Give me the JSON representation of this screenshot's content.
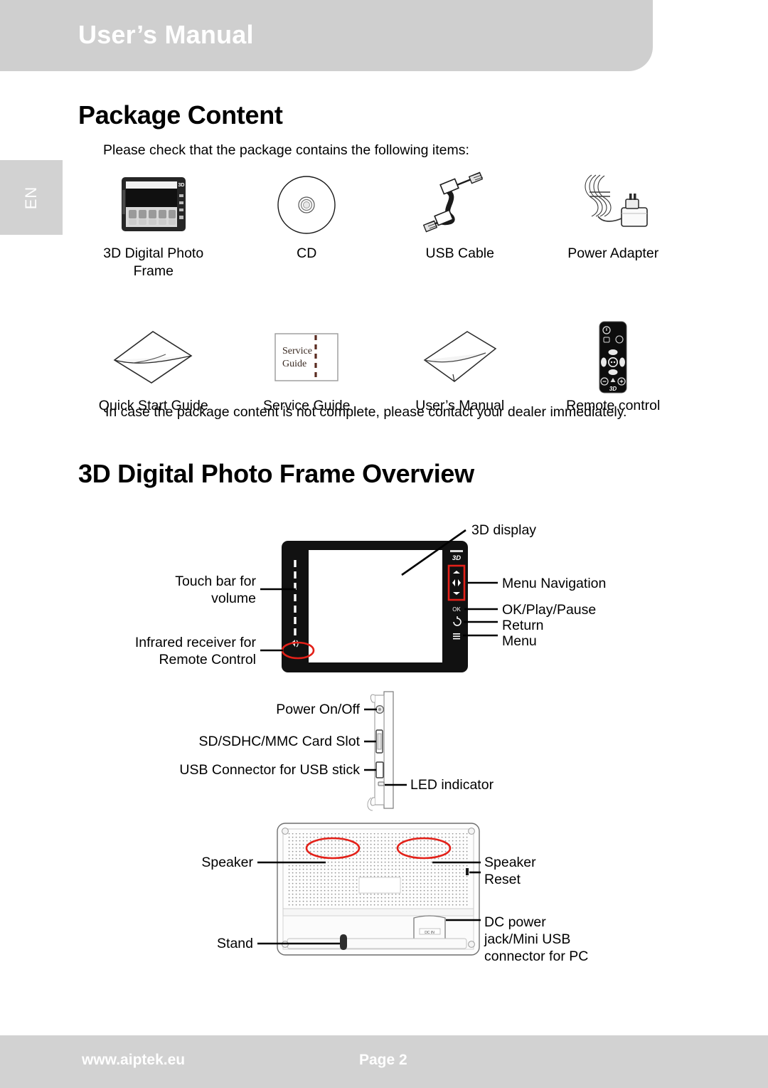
{
  "header": {
    "title": "User’s Manual"
  },
  "language_tab": {
    "label": "EN"
  },
  "footer": {
    "url": "www.aiptek.eu",
    "page": "Page 2"
  },
  "sections": {
    "package": {
      "heading": "Package Content",
      "intro": "Please check that the package contains the following items:",
      "note": "In case the package content is not complete, please contact your dealer immediately.",
      "items": [
        {
          "icon": "photo-frame-icon",
          "label": "3D Digital Photo Frame"
        },
        {
          "icon": "cd-icon",
          "label": "CD"
        },
        {
          "icon": "usb-cable-icon",
          "label": "USB Cable"
        },
        {
          "icon": "power-adapter-icon",
          "label": "Power Adapter"
        },
        {
          "icon": "booklet-icon",
          "label": "Quick Start Guide"
        },
        {
          "icon": "service-guide-icon",
          "label": "Service Guide"
        },
        {
          "icon": "manual-icon",
          "label": "User’s Manual"
        },
        {
          "icon": "remote-control-icon",
          "label": "Remote control"
        }
      ],
      "service_guide_art": {
        "line1": "Service",
        "line2": "Guide"
      }
    },
    "overview": {
      "heading": "3D Digital Photo Frame Overview",
      "front_view": {
        "brand_badge": "3D",
        "callouts_left": [
          {
            "name": "touch-bar-callout",
            "label": "Touch bar for volume"
          },
          {
            "name": "infrared-receiver-callout",
            "label": "Infrared receiver for Remote Control"
          }
        ],
        "callouts_right": [
          {
            "name": "display-callout",
            "label": "3D display"
          },
          {
            "name": "menu-navigation-callout",
            "label": "Menu Navigation"
          },
          {
            "name": "ok-play-pause-callout",
            "label": "OK/Play/Pause"
          },
          {
            "name": "return-callout",
            "label": "Return"
          },
          {
            "name": "menu-callout",
            "label": "Menu"
          }
        ]
      },
      "side_view": {
        "callouts_left": [
          {
            "name": "power-callout",
            "label": "Power On/Off"
          },
          {
            "name": "card-slot-callout",
            "label": "SD/SDHC/MMC Card Slot"
          },
          {
            "name": "usb-connector-callout",
            "label": "USB Connector for USB stick"
          }
        ],
        "callouts_right": [
          {
            "name": "led-indicator-callout",
            "label": "LED indicator"
          }
        ]
      },
      "back_view": {
        "callouts_left": [
          {
            "name": "speaker-left-callout",
            "label": "Speaker"
          },
          {
            "name": "stand-callout",
            "label": "Stand"
          }
        ],
        "callouts_right": [
          {
            "name": "speaker-right-callout",
            "label": "Speaker"
          },
          {
            "name": "reset-callout",
            "label": "Reset"
          },
          {
            "name": "dc-power-callout-line1",
            "label": "DC power"
          },
          {
            "name": "dc-power-callout-line2",
            "label": "jack/Mini USB"
          },
          {
            "name": "dc-power-callout-line3",
            "label": "connector for PC"
          }
        ],
        "reset_marker": "reset"
      }
    }
  },
  "colors": {
    "chrome": "#d2d2d2",
    "header": "#cfcfcf",
    "highlight": "#e32119",
    "text": "#000000"
  }
}
